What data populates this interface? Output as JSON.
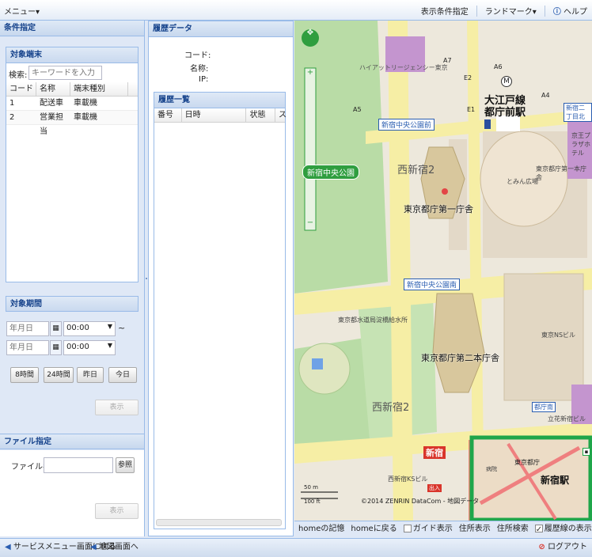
{
  "topbar": {
    "menu": "メニュー▾",
    "display_settings": "表示条件指定",
    "landmark": "ランドマーク▾",
    "help": "ヘルプ"
  },
  "left": {
    "header": "条件指定",
    "target_terminal": {
      "header": "対象端末",
      "search_label": "検索:",
      "search_placeholder": "キーワードを入力",
      "columns": [
        "コード",
        "名称",
        "端末種別"
      ],
      "rows": [
        {
          "code": "1",
          "name": "配送車",
          "type": "車載機"
        },
        {
          "code": "2",
          "name": "営業担当",
          "type": "車載機"
        }
      ]
    },
    "target_period": {
      "header": "対象期間",
      "date_placeholder": "年月日",
      "time1": "00:00",
      "time2": "00:00",
      "tilde": "~",
      "buttons": [
        "8時間",
        "24時間",
        "昨日",
        "今日"
      ],
      "show": "表示"
    },
    "file": {
      "header": "ファイル指定",
      "label": "ファイル名:",
      "browse": "参照",
      "show": "表示"
    }
  },
  "center": {
    "header": "履歴データ",
    "code_label": "コード:",
    "name_label": "名称:",
    "ip_label": "IP:",
    "list_header": "履歴一覧",
    "columns": [
      "番号",
      "日時",
      "状態",
      "ス"
    ]
  },
  "map": {
    "labels": {
      "park": "新宿中央公園",
      "park_north": "新宿中央公園前",
      "park_south": "新宿中央公園南",
      "nishi1": "西新宿2",
      "nishi2": "西新宿2",
      "tocho1": "東京都庁第一庁舎",
      "tocho2": "東京都庁第二本庁舎",
      "station": "大江戸線\n都庁前駅",
      "hyatt": "ハイアットリージェンシー東京",
      "ns": "東京NSビル",
      "hodo": "東京都庁第一本庁舎",
      "shinjuku_tag": "新宿",
      "demo": "出入",
      "nishi_kita": "新宿二丁目北",
      "nishi_minami": "都庁南",
      "ks": "西新宿KSビル",
      "waterworks": "東京都水道局淀橋給水所",
      "dominian": "とみん広場",
      "exits": [
        "A7",
        "A6",
        "E2",
        "A5",
        "E1",
        "A4"
      ],
      "keio": "京王プラザホテル",
      "ritsu": "立花新宿ビル",
      "copyright": "©2014 ZENRIN DataCom - 地図データ",
      "scale_m": "50 m",
      "scale_ft": "100 ft"
    },
    "mini": {
      "station": "新宿駅",
      "tocho": "東京都庁",
      "hospital": "病院"
    }
  },
  "statusbar": {
    "home_save": "homeの記憶",
    "home_back": "homeに戻る",
    "guide": "ガイド表示",
    "addr_show": "住所表示",
    "addr_search": "住所検索",
    "trail": "履歴線の表示"
  },
  "bottom": {
    "back_service": "サービスメニュー画面に戻る",
    "map_screen": "地図画面へ",
    "logout": "ログアウト"
  }
}
